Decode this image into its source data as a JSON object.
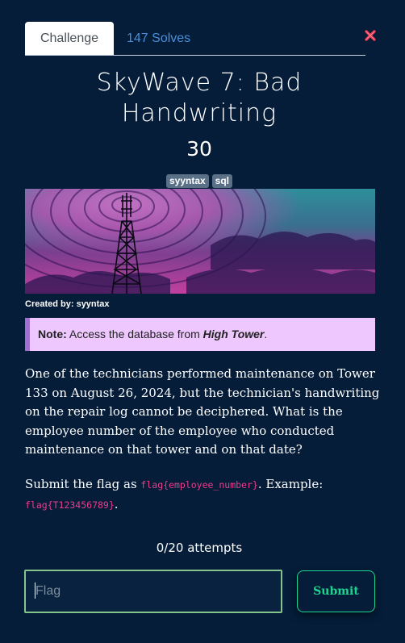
{
  "tabs": {
    "challenge": "Challenge",
    "solves": "147 Solves"
  },
  "challenge": {
    "title": "SkyWave 7: Bad Handwriting",
    "points": "30",
    "tags": [
      "syyntax",
      "sql"
    ],
    "creator": "Created by: syyntax"
  },
  "note": {
    "label": "Note:",
    "text_before": "Access the database from ",
    "emphasis": "High Tower",
    "text_after": "."
  },
  "description": "One of the technicians performed maintenance on Tower 133 on August 26, 2024, but the technician's handwriting on the repair log cannot be deciphered. What is the employee number of the employee who conducted maintenance on that tower and on that date?",
  "submit_instructions": {
    "prefix": "Submit the flag as ",
    "flag_format": "flag{employee_number}",
    "middle": ". Example:",
    "example": "flag{T123456789}",
    "suffix": "."
  },
  "attempts": "0/20 attempts",
  "form": {
    "flag_placeholder": "Flag",
    "flag_value": "",
    "submit_label": "Submit"
  },
  "colors": {
    "background": "#051d39",
    "accent_green": "#1bd591",
    "solves_blue": "#4a8ed8",
    "note_bg": "#edc7fd",
    "code_pink": "#e83e8c",
    "close_red": "#e0334e"
  },
  "icons": {
    "close": "close-x-icon"
  }
}
